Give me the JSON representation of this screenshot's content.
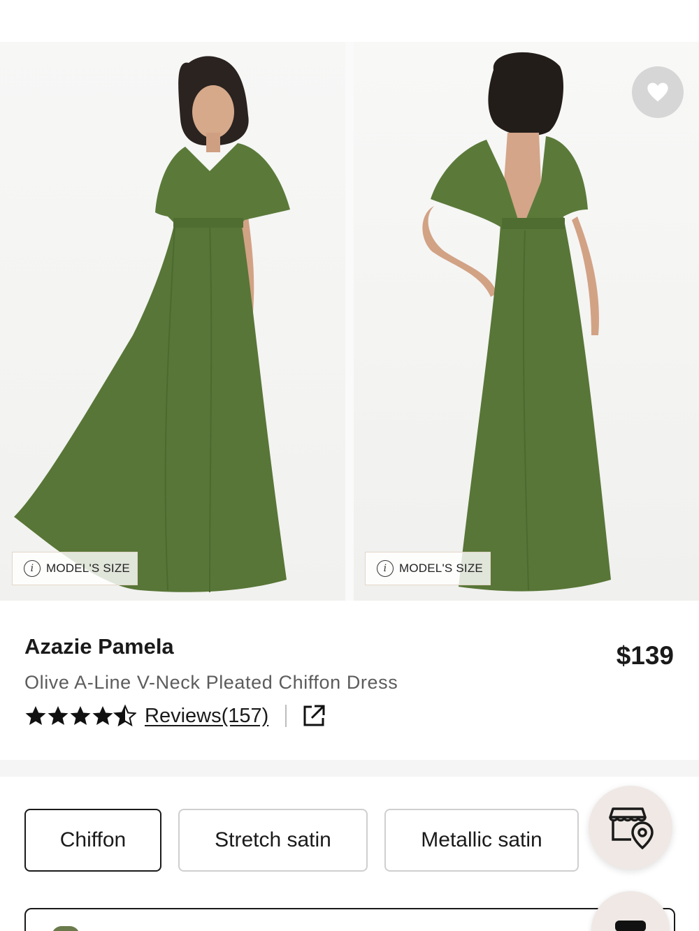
{
  "gallery": {
    "model_size_label": "MODEL'S SIZE",
    "favorite_icon": "heart-icon",
    "dress_color": "#5b7a3a"
  },
  "product": {
    "brand": "Azazie Pamela",
    "title": "Olive A-Line V-Neck Pleated Chiffon Dress",
    "price": "$139",
    "rating": 4.5,
    "reviews_label": "Reviews(157)",
    "share_icon": "external-link-icon"
  },
  "fabric_options": [
    {
      "label": "Chiffon",
      "selected": true
    },
    {
      "label": "Stretch satin",
      "selected": false
    },
    {
      "label": "Metallic satin",
      "selected": false
    }
  ],
  "store_locator_icon": "store-location-icon",
  "colors": {
    "accent_bg": "#efe8e5",
    "text": "#1a1a1a",
    "muted": "#5c5c5c"
  }
}
